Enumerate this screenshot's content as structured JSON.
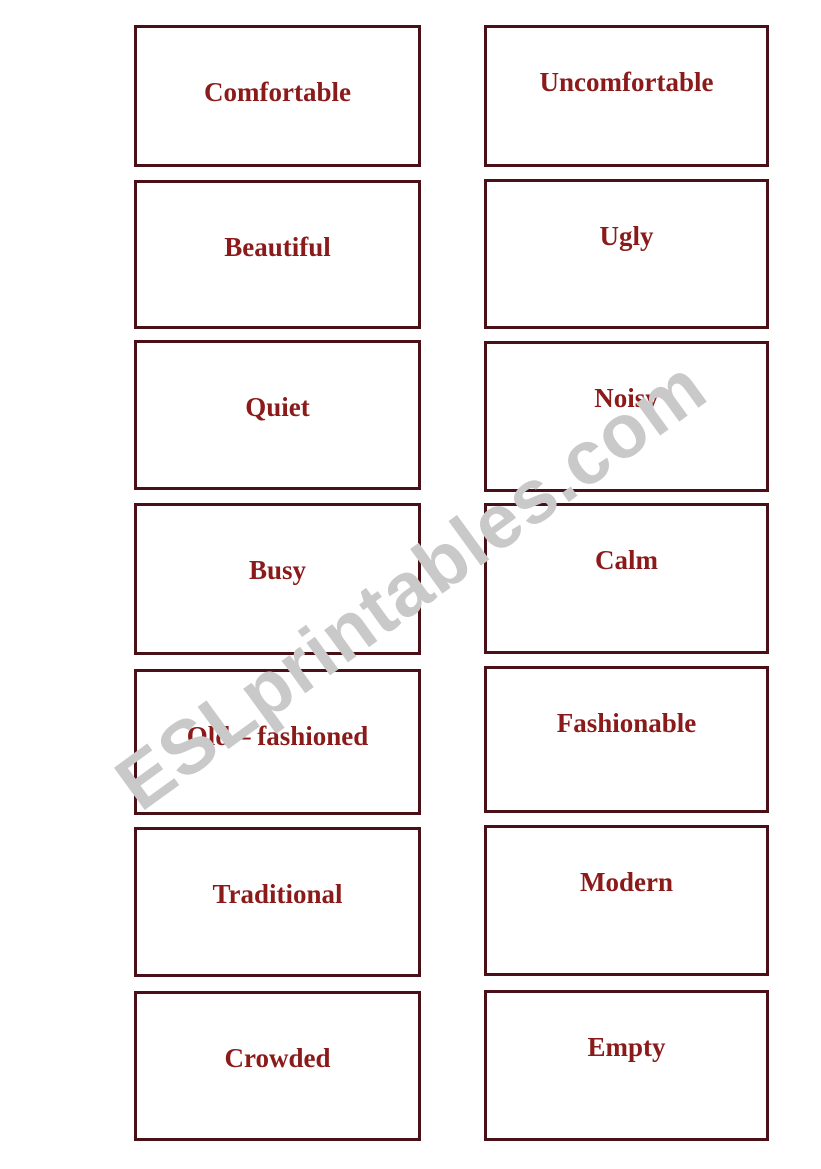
{
  "page": {
    "kind": "flashcard-worksheet",
    "background_color": "#ffffff",
    "border_color": "#4a1018",
    "text_color": "#8b1a1a"
  },
  "watermark": {
    "text": "ESLprintables.com",
    "color": "#c9c9c9"
  },
  "columns": {
    "left": {
      "cards": [
        {
          "label": "Comfortable"
        },
        {
          "label": "Beautiful"
        },
        {
          "label": "Quiet"
        },
        {
          "label": "Busy"
        },
        {
          "label": "Old – fashioned"
        },
        {
          "label": "Traditional"
        },
        {
          "label": "Crowded"
        }
      ]
    },
    "right": {
      "cards": [
        {
          "label": "Uncomfortable"
        },
        {
          "label": "Ugly"
        },
        {
          "label": "Noisy"
        },
        {
          "label": "Calm"
        },
        {
          "label": "Fashionable"
        },
        {
          "label": "Modern"
        },
        {
          "label": "Empty"
        }
      ]
    }
  }
}
